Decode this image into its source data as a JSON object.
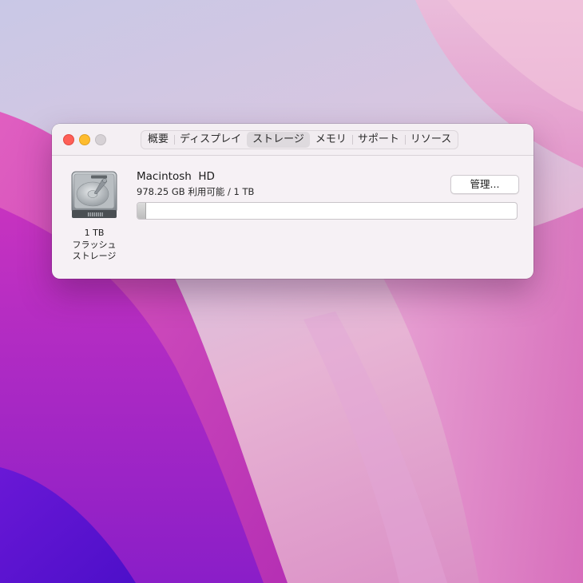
{
  "window": {
    "tabs": [
      {
        "label": "概要",
        "selected": false
      },
      {
        "label": "ディスプレイ",
        "selected": false
      },
      {
        "label": "ストレージ",
        "selected": true
      },
      {
        "label": "メモリ",
        "selected": false
      },
      {
        "label": "サポート",
        "selected": false
      },
      {
        "label": "リソース",
        "selected": false
      }
    ]
  },
  "storage": {
    "drive": {
      "icon": "hard-drive-icon",
      "caption": [
        "1 TB",
        "フラッシュ",
        "ストレージ"
      ]
    },
    "volume": {
      "name": "Macintosh  HD",
      "capacity": "978.25 GB 利用可能 / 1 TB",
      "used_fraction": 0.022
    },
    "manage_label": "管理..."
  },
  "colors": {
    "close": "#fe5f57",
    "minimize": "#febc2e",
    "zoom": "#d6d1d5",
    "window_bg": "#f6f1f5"
  }
}
